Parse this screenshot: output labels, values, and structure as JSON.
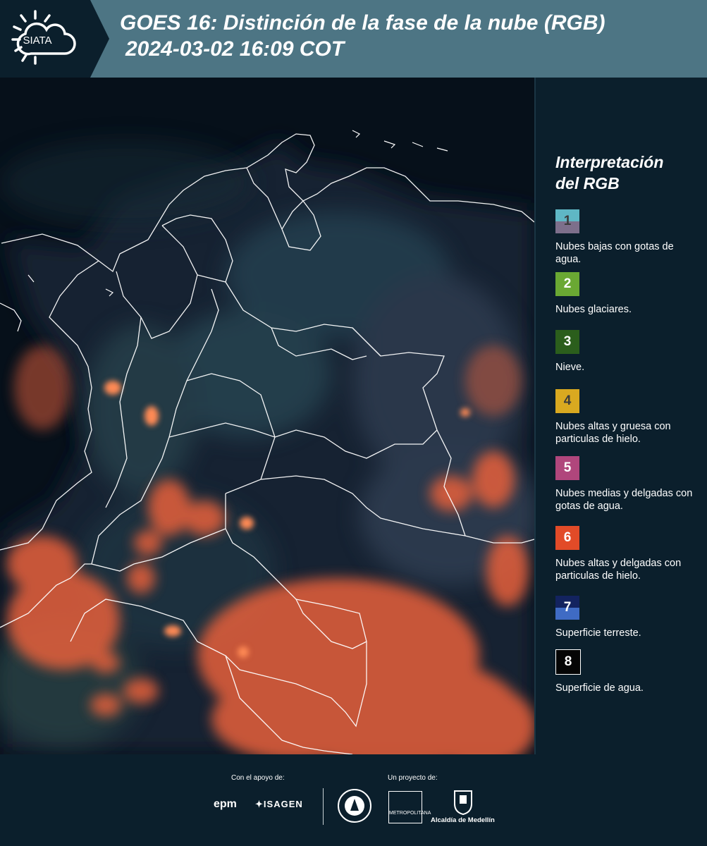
{
  "header": {
    "logo_text": "SIATA",
    "title": "GOES 16: Distinción de la fase de la nube (RGB)",
    "subtitle": "2024-03-02 16:09 COT"
  },
  "legend": {
    "title_line1": "Interpretación",
    "title_line2": "del RGB",
    "entries": [
      {
        "num": "1",
        "label": "Nubes bajas con gotas de agua.",
        "colors": [
          "#5fb7c5",
          "#7d6f8b"
        ]
      },
      {
        "num": "2",
        "label": "Nubes glaciares.",
        "colors": [
          "#6aa833"
        ]
      },
      {
        "num": "3",
        "label": "Nieve.",
        "colors": [
          "#2b5e1c"
        ]
      },
      {
        "num": "4",
        "label": "Nubes altas y gruesa con particulas de hielo.",
        "colors": [
          "#d9a920"
        ]
      },
      {
        "num": "5",
        "label": "Nubes medias y delgadas con gotas de agua.",
        "colors": [
          "#b0467c"
        ]
      },
      {
        "num": "6",
        "label": "Nubes altas y delgadas con particulas de hielo.",
        "colors": [
          "#e24b28"
        ]
      },
      {
        "num": "7",
        "label": "Superficie terreste.",
        "colors": [
          "#13235f",
          "#3f6bc4"
        ]
      },
      {
        "num": "8",
        "label": "Superficie de agua.",
        "colors": [
          "#050505"
        ]
      }
    ]
  },
  "footer": {
    "support_label": "Con el apoyo de:",
    "project_label": "Un proyecto de:",
    "sponsor1": "epm",
    "sponsor2": "ISAGEN",
    "partner1": "METROPOLITANA",
    "partner2": "Alcaldía de Medellín"
  }
}
